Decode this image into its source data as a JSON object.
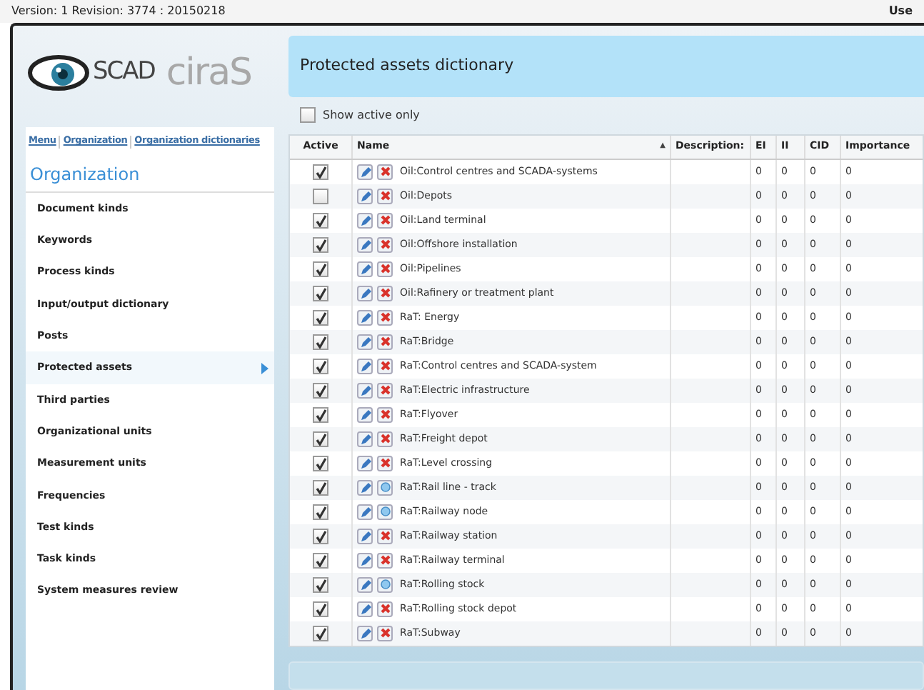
{
  "top_bar": {
    "version": "Version: 1 Revision: 3774 : 20150218",
    "user": "Use"
  },
  "logo": {
    "part_1": "SCAD",
    "part_2": "ciraS"
  },
  "breadcrumb": [
    "Menu",
    "Organization",
    "Organization dictionaries"
  ],
  "sidebar": {
    "title": "Organization",
    "items": [
      {
        "label": "Document kinds",
        "selected": false
      },
      {
        "label": "Keywords",
        "selected": false
      },
      {
        "label": "Process kinds",
        "selected": false
      },
      {
        "label": "Input/output dictionary",
        "selected": false
      },
      {
        "label": "Posts",
        "selected": false
      },
      {
        "label": "Protected assets",
        "selected": true
      },
      {
        "label": "Third parties",
        "selected": false
      },
      {
        "label": "Organizational units",
        "selected": false
      },
      {
        "label": "Measurement units",
        "selected": false
      },
      {
        "label": "Frequencies",
        "selected": false
      },
      {
        "label": "Test kinds",
        "selected": false
      },
      {
        "label": "Task kinds",
        "selected": false
      },
      {
        "label": "System measures review",
        "selected": false
      }
    ]
  },
  "page_title": "Protected assets dictionary",
  "filter": {
    "label": "Show active only",
    "checked": false
  },
  "table": {
    "columns": [
      "Active",
      "Name",
      "Description:",
      "EI",
      "II",
      "CID",
      "Importance"
    ],
    "sort_mark": "▲",
    "rows": [
      {
        "active": true,
        "kind": "delete",
        "name": "Oil:Control centres and SCADA-systems",
        "ei": "0",
        "ii": "0",
        "cid": "0",
        "importance": "0"
      },
      {
        "active": false,
        "kind": "delete",
        "name": "Oil:Depots",
        "ei": "0",
        "ii": "0",
        "cid": "0",
        "importance": "0"
      },
      {
        "active": true,
        "kind": "delete",
        "name": "Oil:Land terminal",
        "ei": "0",
        "ii": "0",
        "cid": "0",
        "importance": "0"
      },
      {
        "active": true,
        "kind": "delete",
        "name": "Oil:Offshore installation",
        "ei": "0",
        "ii": "0",
        "cid": "0",
        "importance": "0"
      },
      {
        "active": true,
        "kind": "delete",
        "name": "Oil:Pipelines",
        "ei": "0",
        "ii": "0",
        "cid": "0",
        "importance": "0"
      },
      {
        "active": true,
        "kind": "delete",
        "name": "Oil:Rafinery or treatment plant",
        "ei": "0",
        "ii": "0",
        "cid": "0",
        "importance": "0"
      },
      {
        "active": true,
        "kind": "delete",
        "name": "RaT: Energy",
        "ei": "0",
        "ii": "0",
        "cid": "0",
        "importance": "0"
      },
      {
        "active": true,
        "kind": "delete",
        "name": "RaT:Bridge",
        "ei": "0",
        "ii": "0",
        "cid": "0",
        "importance": "0"
      },
      {
        "active": true,
        "kind": "delete",
        "name": "RaT:Control centres and SCADA-system",
        "ei": "0",
        "ii": "0",
        "cid": "0",
        "importance": "0"
      },
      {
        "active": true,
        "kind": "delete",
        "name": "RaT:Electric infrastructure",
        "ei": "0",
        "ii": "0",
        "cid": "0",
        "importance": "0"
      },
      {
        "active": true,
        "kind": "delete",
        "name": "RaT:Flyover",
        "ei": "0",
        "ii": "0",
        "cid": "0",
        "importance": "0"
      },
      {
        "active": true,
        "kind": "delete",
        "name": "RaT:Freight depot",
        "ei": "0",
        "ii": "0",
        "cid": "0",
        "importance": "0"
      },
      {
        "active": true,
        "kind": "delete",
        "name": "RaT:Level crossing",
        "ei": "0",
        "ii": "0",
        "cid": "0",
        "importance": "0"
      },
      {
        "active": true,
        "kind": "view",
        "name": "RaT:Rail line - track",
        "ei": "0",
        "ii": "0",
        "cid": "0",
        "importance": "0"
      },
      {
        "active": true,
        "kind": "view",
        "name": "RaT:Railway node",
        "ei": "0",
        "ii": "0",
        "cid": "0",
        "importance": "0"
      },
      {
        "active": true,
        "kind": "delete",
        "name": "RaT:Railway station",
        "ei": "0",
        "ii": "0",
        "cid": "0",
        "importance": "0"
      },
      {
        "active": true,
        "kind": "delete",
        "name": "RaT:Railway terminal",
        "ei": "0",
        "ii": "0",
        "cid": "0",
        "importance": "0"
      },
      {
        "active": true,
        "kind": "view",
        "name": "RaT:Rolling stock",
        "ei": "0",
        "ii": "0",
        "cid": "0",
        "importance": "0"
      },
      {
        "active": true,
        "kind": "delete",
        "name": "RaT:Rolling stock depot",
        "ei": "0",
        "ii": "0",
        "cid": "0",
        "importance": "0"
      },
      {
        "active": true,
        "kind": "delete",
        "name": "RaT:Subway",
        "ei": "0",
        "ii": "0",
        "cid": "0",
        "importance": "0"
      }
    ]
  }
}
